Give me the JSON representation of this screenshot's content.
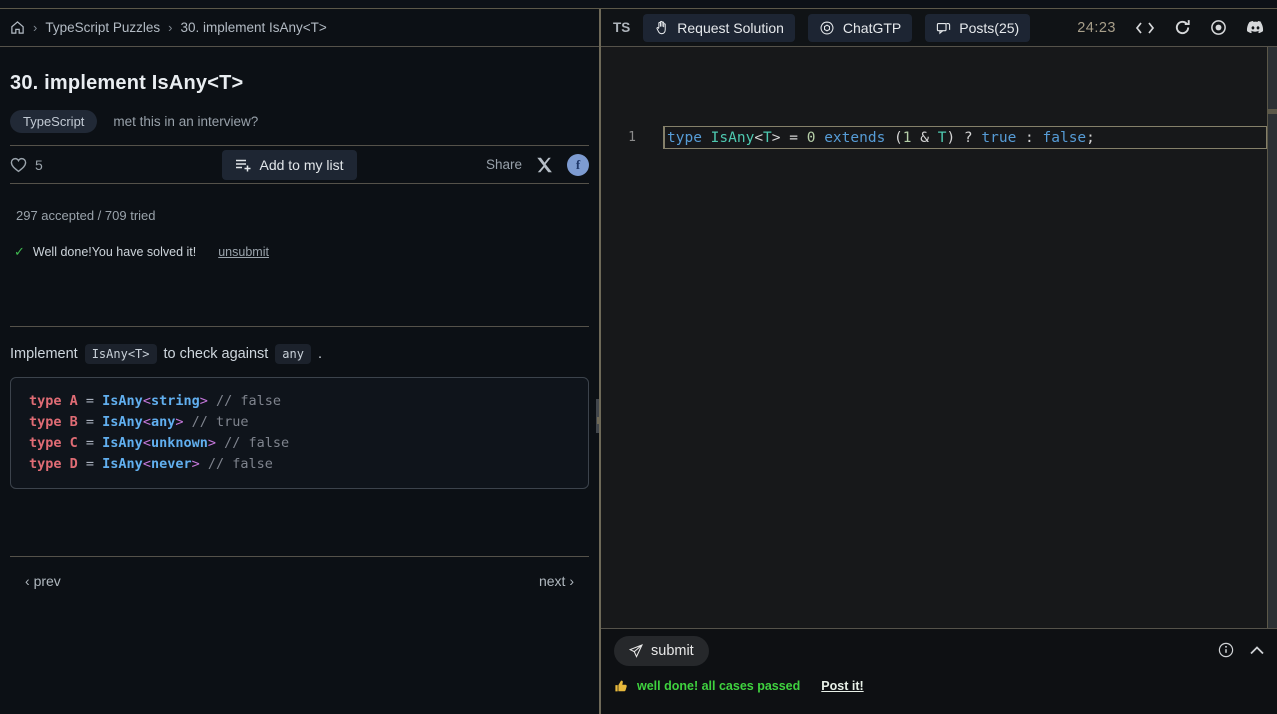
{
  "colors": {
    "panel_divider": "#6e6958",
    "rule": "#55524a",
    "success_green": "#3fd23f",
    "check_green": "#3fb950",
    "facebook_blue": "#7d9bd1",
    "timer_tan": "#a89f8a"
  },
  "left": {
    "breadcrumb": {
      "sep": "›",
      "items": [
        "TypeScript Puzzles",
        "30. implement IsAny<T>"
      ]
    },
    "title": "30. implement IsAny<T>",
    "badge": "TypeScript",
    "interview": "met this in an interview?",
    "likes_count": "5",
    "add_to_list": "Add to my list",
    "share_label": "Share",
    "facebook_letter": "f",
    "stats": "297 accepted / 709 tried",
    "check_glyph": "✓",
    "solved_text": "Well done!You have solved it!",
    "unsubmit": "unsubmit",
    "desc": {
      "prefix": "Implement",
      "code1": "IsAny<T>",
      "middle": "to check against",
      "code2": "any",
      "suffix": "."
    },
    "code_lines": [
      [
        [
          "type ",
          "kw"
        ],
        [
          "A ",
          "kw"
        ],
        [
          "= ",
          "op"
        ],
        [
          "IsAny",
          "fn"
        ],
        [
          "<",
          "br"
        ],
        [
          "string",
          "fn"
        ],
        [
          "> ",
          "br"
        ],
        [
          "// false",
          "cm"
        ]
      ],
      [
        [
          "type ",
          "kw"
        ],
        [
          "B ",
          "kw"
        ],
        [
          "= ",
          "op"
        ],
        [
          "IsAny",
          "fn"
        ],
        [
          "<",
          "br"
        ],
        [
          "any",
          "fn"
        ],
        [
          "> ",
          "br"
        ],
        [
          "// true",
          "cm"
        ]
      ],
      [
        [
          "type ",
          "kw"
        ],
        [
          "C ",
          "kw"
        ],
        [
          "= ",
          "op"
        ],
        [
          "IsAny",
          "fn"
        ],
        [
          "<",
          "br"
        ],
        [
          "unknown",
          "fn"
        ],
        [
          "> ",
          "br"
        ],
        [
          "// false",
          "cm"
        ]
      ],
      [
        [
          "type ",
          "kw"
        ],
        [
          "D ",
          "kw"
        ],
        [
          "= ",
          "op"
        ],
        [
          "IsAny",
          "fn"
        ],
        [
          "<",
          "br"
        ],
        [
          "never",
          "fn"
        ],
        [
          "> ",
          "br"
        ],
        [
          "// false",
          "cm"
        ]
      ]
    ],
    "prev_arrow": "‹",
    "prev": "prev",
    "next": "next",
    "next_arrow": "›"
  },
  "right": {
    "ts_label": "TS",
    "request_solution": "Request Solution",
    "chatgtp": "ChatGTP",
    "posts": "Posts(25)",
    "timer": "24:23",
    "editor": {
      "line_number": "1",
      "tokens": [
        [
          "type ",
          "kw"
        ],
        [
          "IsAny",
          "ty"
        ],
        [
          "<",
          "pu"
        ],
        [
          "T",
          "ty"
        ],
        [
          "> ",
          "pu"
        ],
        [
          "= ",
          "pu"
        ],
        [
          "0 ",
          "num"
        ],
        [
          "extends ",
          "kw"
        ],
        [
          "(",
          "pu"
        ],
        [
          "1 ",
          "num"
        ],
        [
          "& ",
          "pu"
        ],
        [
          "T",
          "ty"
        ],
        [
          ") ",
          "pu"
        ],
        [
          "? ",
          "pu"
        ],
        [
          "true ",
          "kw"
        ],
        [
          ": ",
          "pu"
        ],
        [
          "false",
          "kw"
        ],
        [
          ";",
          "pu"
        ]
      ]
    },
    "submit": "submit",
    "status": "well done! all cases passed",
    "post_it": "Post it!"
  }
}
